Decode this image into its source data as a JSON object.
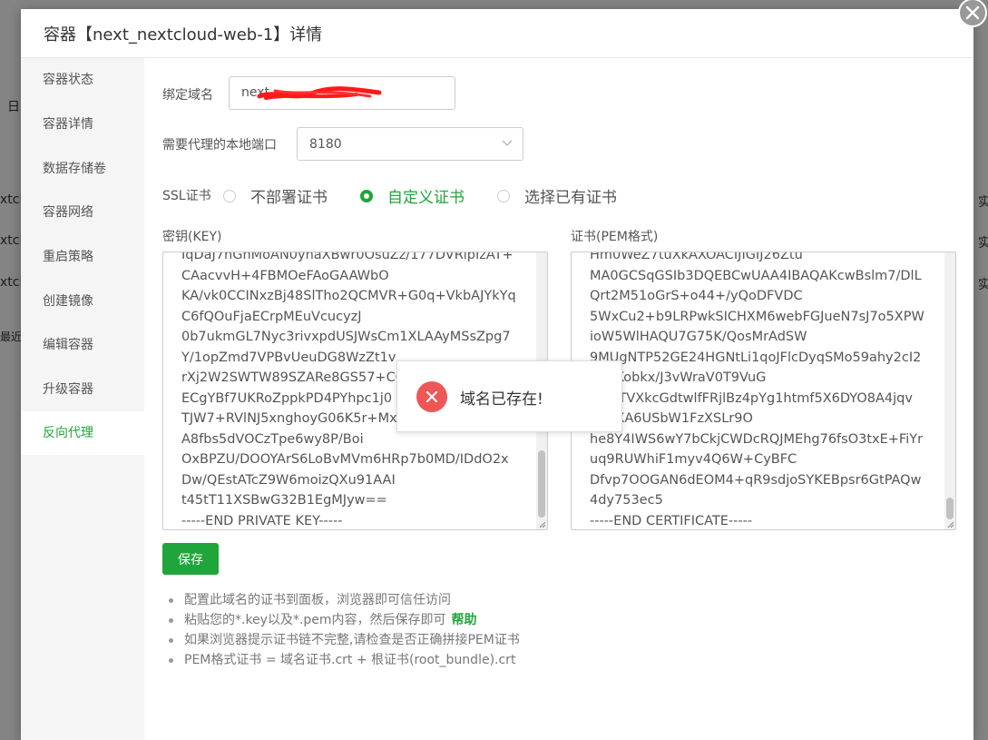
{
  "background": {
    "fragments": [
      "日",
      "xtcl",
      "xtcl",
      "xtcl",
      "最近",
      "实",
      "实",
      "实"
    ]
  },
  "dialog": {
    "title": "容器【next_nextcloud-web-1】详情"
  },
  "sidebar": {
    "items": [
      {
        "label": "容器状态"
      },
      {
        "label": "容器详情"
      },
      {
        "label": "数据存储卷"
      },
      {
        "label": "容器网络"
      },
      {
        "label": "重启策略"
      },
      {
        "label": "创建镜像"
      },
      {
        "label": "编辑容器"
      },
      {
        "label": "升级容器"
      },
      {
        "label": "反向代理",
        "active": true
      }
    ]
  },
  "form": {
    "domain_label": "绑定域名",
    "domain_value": "next",
    "port_label": "需要代理的本地端口",
    "port_value": "8180",
    "ssl_label": "SSL证书",
    "ssl_options": [
      {
        "label": "不部署证书",
        "checked": false
      },
      {
        "label": "自定义证书",
        "checked": true
      },
      {
        "label": "选择已有证书",
        "checked": false
      }
    ],
    "key_label": "密钥(KEY)",
    "key_lines": [
      "IqDaJ7nGnMoAN0ynaXBwr0OsuZz/177DVRipIzAT+",
      "CAacvvH+4FBMOeFAoGAAWbO",
      "KA/vk0CCINxzBj48SlTho2QCMVR+G0q+VkbAJYkYq",
      "C6fQOuFjaECrpMEuVcucyzJ",
      "0b7ukmGL7Nyc3rivxpdUSJWsCm1XLAAyMSsZpg7",
      "Y/1opZmd7VPBvUeuDG8WzZt1v",
      "rXj2W2SWTW89SZARe8GS57+CC",
      "ECgYBf7UKRoZppkPD4PYhpc1j0",
      "TJW7+RVlNJ5xnghoyG06K5r+Mx",
      "A8fbs5dVOCzTpe6wy8P/Boi",
      "OxBPZU/DOOYArS6LoBvMVm6HRp7b0MD/IDdO2x",
      "Dw/QEstATcZ9W6moizQXu91AAI",
      "t45tT11XSBwG32B1EgMJyw==",
      "-----END PRIVATE KEY-----"
    ],
    "cert_label": "证书(PEM格式)",
    "cert_lines": [
      "Hm0WeZ7tuXkAXOACIJIGIJ26Ztu",
      "MA0GCSqGSIb3DQEBCwUAA4IBAQAKcwBslm7/DlL",
      "Qrt2M51oGrS+o44+/yQoDFVDC",
      "5WxCu2+b9LRPwkSICHXM6webFGJueN7sJ7o5XPW",
      "ioW5WlHAQU7G75K/QosMrAdSW",
      "9MUgNTP52GE24HGNtLi1qoJFlcDyqSMo59ahy2cI2",
      "3DLKobkx/J3vWraV0T9VuG",
      "/CLKTVXkcGdtwlfFRjlBz4pYg1htmf5X6DYO8A4jqv",
      "l9DjXA6USbW1FzXSLr9O",
      "he8Y4IWS6wY7bCkjCWDcRQJMEhg76fsO3txE+FiYr",
      "uq9RUWhiF1myv4Q6W+CyBFC",
      "Dfvp7OOGAN6dEOM4+qR9sdjoSYKEBpsr6GtPAQw",
      "4dy753ec5",
      "-----END CERTIFICATE-----"
    ],
    "save_label": "保存"
  },
  "tips": [
    {
      "text": "配置此域名的证书到面板，浏览器即可信任访问"
    },
    {
      "text": "粘贴您的*.key以及*.pem内容，然后保存即可",
      "link": "帮助"
    },
    {
      "text": "如果浏览器提示证书链不完整,请检查是否正确拼接PEM证书"
    },
    {
      "text": "PEM格式证书 = 域名证书.crt + 根证书(root_bundle).crt"
    }
  ],
  "toast": {
    "message": "域名已存在!"
  },
  "colors": {
    "accent": "#20a53a",
    "error": "#ef5757"
  },
  "icons": [
    "close-icon",
    "chevron-down-icon",
    "error-icon"
  ]
}
